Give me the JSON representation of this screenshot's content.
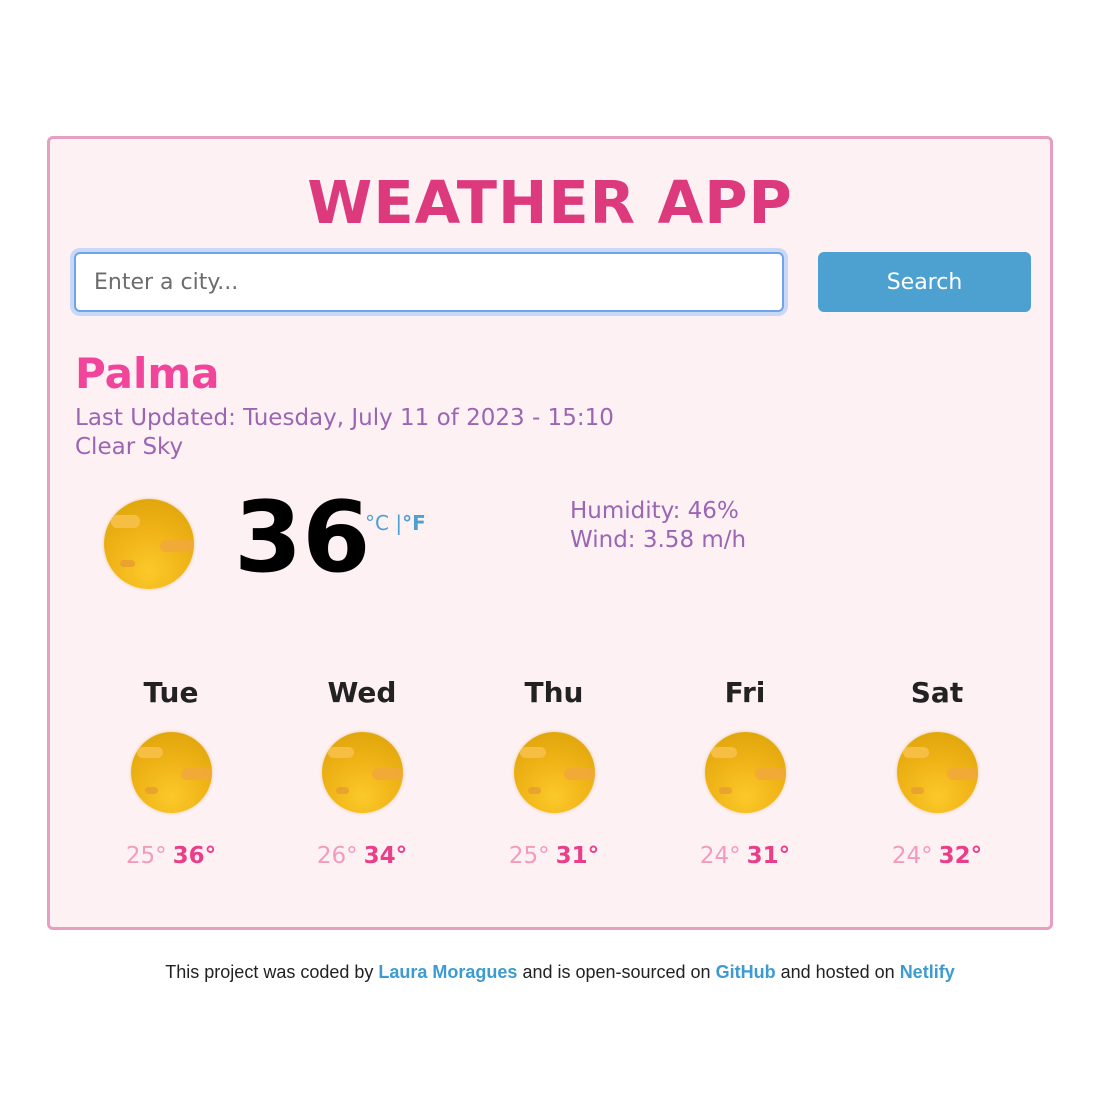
{
  "app": {
    "title": "WEATHER APP"
  },
  "search": {
    "placeholder": "Enter a city...",
    "button_label": "Search"
  },
  "current": {
    "city": "Palma",
    "last_updated": "Last Updated: Tuesday, July 11 of 2023 - 15:10",
    "description": "Clear Sky",
    "icon": "sun-icon",
    "temperature": "36",
    "unit_celsius": "°C",
    "unit_separator": "|",
    "unit_fahrenheit": "°F",
    "humidity": "Humidity: 46%",
    "wind": "Wind: 3.58 m/h"
  },
  "forecast": [
    {
      "day": "Tue",
      "icon": "sun-icon",
      "min": "25°",
      "max": "36°"
    },
    {
      "day": "Wed",
      "icon": "sun-icon",
      "min": "26°",
      "max": "34°"
    },
    {
      "day": "Thu",
      "icon": "sun-icon",
      "min": "25°",
      "max": "31°"
    },
    {
      "day": "Fri",
      "icon": "sun-icon",
      "min": "24°",
      "max": "31°"
    },
    {
      "day": "Sat",
      "icon": "sun-icon",
      "min": "24°",
      "max": "32°"
    }
  ],
  "footer": {
    "text_1": "This project was coded by ",
    "author_link": "Laura Moragues",
    "text_2": " and is open-sourced on ",
    "github_link": "GitHub",
    "text_3": " and hosted on ",
    "netlify_link": "Netlify"
  },
  "colors": {
    "title": "#dc3a7c",
    "city": "#f0459a",
    "secondary_text": "#9b65b4",
    "button": "#4ca1d1",
    "card_background": "#fdf1f4",
    "card_border": "#e59fc0",
    "link": "#3d9bd1"
  }
}
